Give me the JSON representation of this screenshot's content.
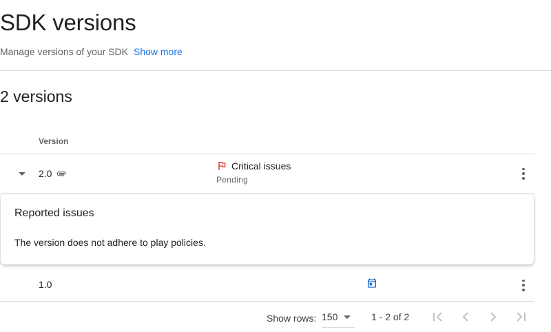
{
  "header": {
    "title": "SDK versions",
    "subtitle": "Manage versions of your SDK",
    "show_more_label": "Show more"
  },
  "section": {
    "title": "2 versions"
  },
  "table": {
    "columns": {
      "version": "Version"
    },
    "rows": [
      {
        "version": "2.0",
        "status": "Critical issues",
        "status_sub": "Pending",
        "expanded": true,
        "details": {
          "title": "Reported issues",
          "text": "The version does not adhere to play policies."
        }
      },
      {
        "version": "1.0"
      }
    ]
  },
  "pagination": {
    "show_rows_label": "Show rows:",
    "rows_value": "150",
    "range_text": "1 - 2 of 2"
  },
  "colors": {
    "accent": "#1a73e8",
    "critical": "#d93025",
    "text": "#202124",
    "muted": "#5f6368",
    "divider": "#dadce0",
    "disabled": "#bdc1c6"
  },
  "icons": {
    "attachment": "paperclip-icon",
    "status": "flag-icon",
    "date": "calendar-icon",
    "menu": "more-vert-icon",
    "first": "first-page-icon",
    "prev": "chevron-left-icon",
    "next": "chevron-right-icon",
    "last": "last-page-icon"
  }
}
